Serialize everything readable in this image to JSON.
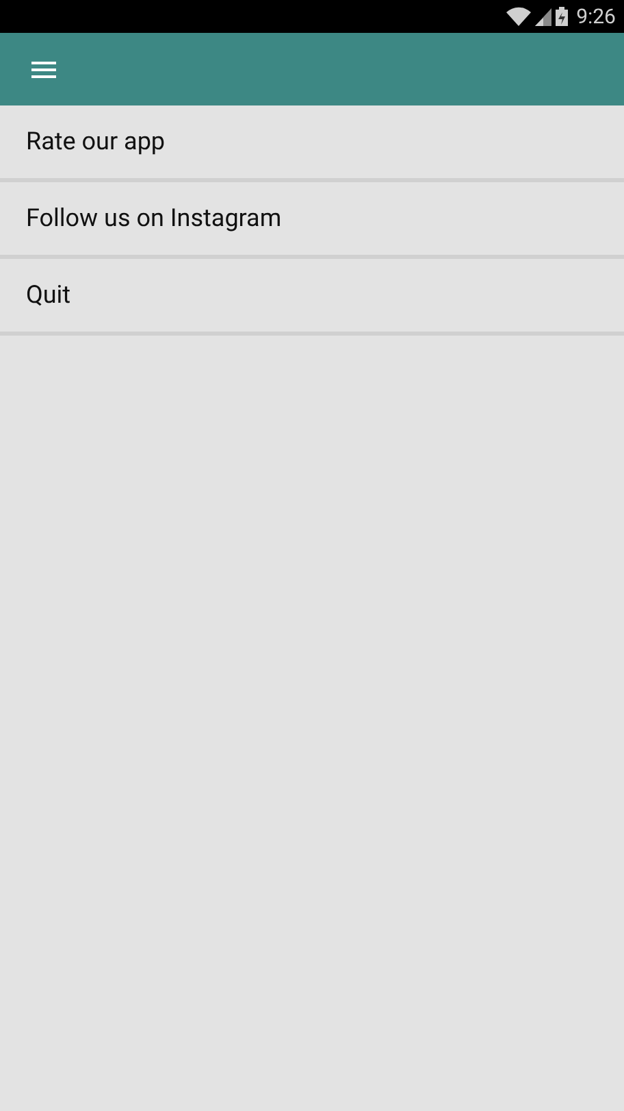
{
  "status_bar": {
    "time": "9:26"
  },
  "menu": [
    {
      "label": "Rate our app"
    },
    {
      "label": "Follow us on Instagram"
    },
    {
      "label": "Quit"
    }
  ]
}
